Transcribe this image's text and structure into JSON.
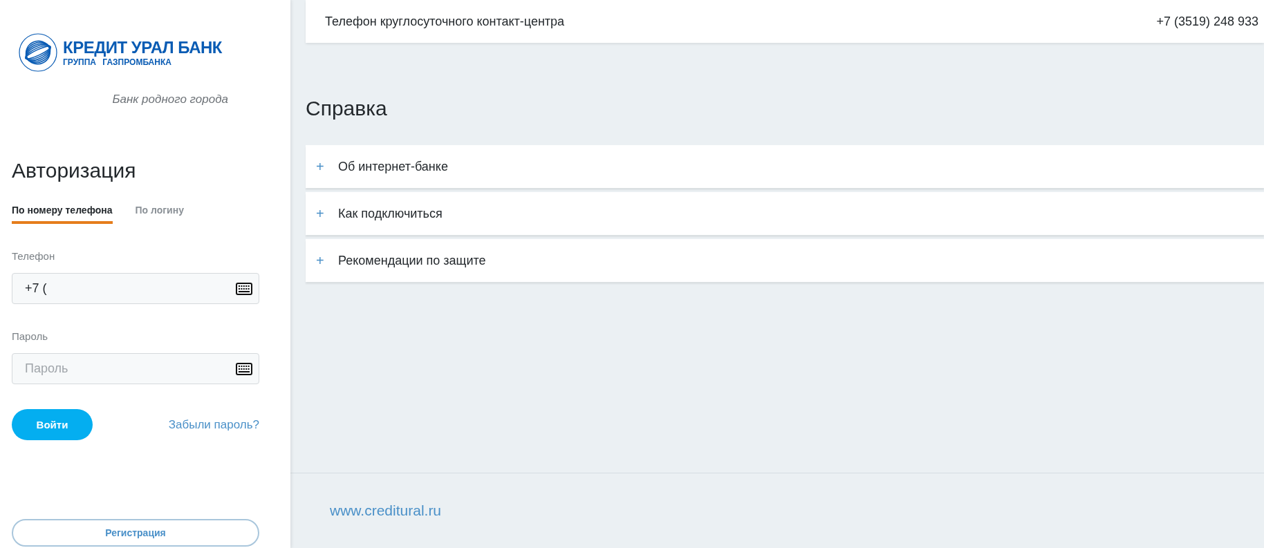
{
  "logo": {
    "name": "КРЕДИТ УРАЛ БАНК",
    "subtitle": "ГРУППА ГАЗПРОМБАНКА"
  },
  "tagline": "Банк родного города",
  "auth": {
    "title": "Авторизация",
    "tabs": [
      {
        "label": "По номеру телефона",
        "selected": true
      },
      {
        "label": "По логину",
        "selected": false
      }
    ],
    "fields": [
      {
        "label": "Телефон",
        "value": "+7 ("
      },
      {
        "label": "Пароль",
        "placeholder": "Пароль"
      }
    ],
    "submit": "Войти",
    "forgot": "Забыли пароль?",
    "register": "Регистрация"
  },
  "contact": {
    "label": "Телефон круглосуточного контакт-центра",
    "phone": "+7 (3519) 248 933"
  },
  "help": {
    "title": "Справка",
    "items": [
      {
        "icon": "+",
        "label": "Об интернет-банке"
      },
      {
        "icon": "+",
        "label": "Как подключиться"
      },
      {
        "icon": "+",
        "label": "Рекомендации по защите"
      }
    ]
  },
  "footer": {
    "link": "www.creditural.ru"
  }
}
